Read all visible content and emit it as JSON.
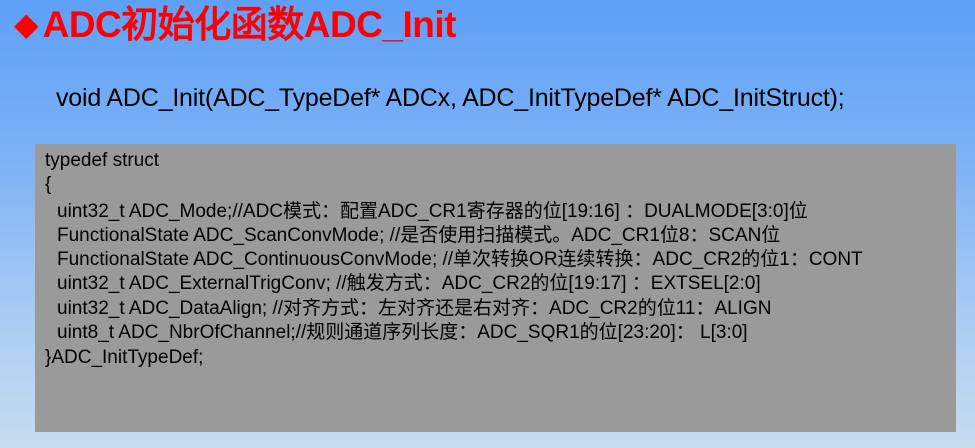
{
  "title": {
    "bullet": "◆",
    "text": "ADC初始化函数ADC_Init"
  },
  "signature": "void ADC_Init(ADC_TypeDef* ADCx, ADC_InitTypeDef* ADC_InitStruct);",
  "code": {
    "lines": [
      "typedef struct",
      "{",
      "uint32_t ADC_Mode;//ADC模式：配置ADC_CR1寄存器的位[19:16]  ：DUALMODE[3:0]位",
      "FunctionalState ADC_ScanConvMode; //是否使用扫描模式。ADC_CR1位8：SCAN位",
      "FunctionalState ADC_ContinuousConvMode; //单次转换OR连续转换：ADC_CR2的位1：CONT",
      "uint32_t ADC_ExternalTrigConv;  //触发方式：ADC_CR2的位[19:17] ：EXTSEL[2:0]",
      "uint32_t ADC_DataAlign;   //对齐方式：左对齐还是右对齐：ADC_CR2的位11：ALIGN",
      "uint8_t ADC_NbrOfChannel;//规则通道序列长度：ADC_SQR1的位[23:20]： L[3:0]",
      "}ADC_InitTypeDef;"
    ]
  }
}
